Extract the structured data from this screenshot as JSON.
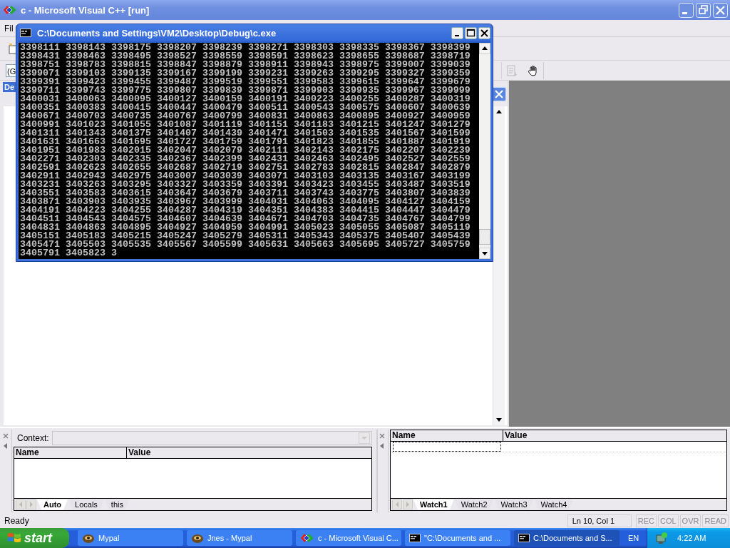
{
  "window": {
    "title": "c - Microsoft Visual C++ [run]"
  },
  "menu": [
    "Fil"
  ],
  "toolbar": {
    "combo": "(G"
  },
  "workspace_pane": {
    "title": "De"
  },
  "console": {
    "title": "C:\\Documents and Settings\\VM2\\Desktop\\Debug\\c.exe",
    "lines": [
      "3398111 3398143 3398175 3398207 3398239 3398271 3398303 3398335 3398367 3398399",
      "3398431 3398463 3398495 3398527 3398559 3398591 3398623 3398655 3398687 3398719",
      "3398751 3398783 3398815 3398847 3398879 3398911 3398943 3398975 3399007 3399039",
      "3399071 3399103 3399135 3399167 3399199 3399231 3399263 3399295 3399327 3399359",
      "3399391 3399423 3399455 3399487 3399519 3399551 3399583 3399615 3399647 3399679",
      "3399711 3399743 3399775 3399807 3399839 3399871 3399903 3399935 3399967 3399999",
      "3400031 3400063 3400095 3400127 3400159 3400191 3400223 3400255 3400287 3400319",
      "3400351 3400383 3400415 3400447 3400479 3400511 3400543 3400575 3400607 3400639",
      "3400671 3400703 3400735 3400767 3400799 3400831 3400863 3400895 3400927 3400959",
      "3400991 3401023 3401055 3401087 3401119 3401151 3401183 3401215 3401247 3401279",
      "3401311 3401343 3401375 3401407 3401439 3401471 3401503 3401535 3401567 3401599",
      "3401631 3401663 3401695 3401727 3401759 3401791 3401823 3401855 3401887 3401919",
      "3401951 3401983 3402015 3402047 3402079 3402111 3402143 3402175 3402207 3402239",
      "3402271 3402303 3402335 3402367 3402399 3402431 3402463 3402495 3402527 3402559",
      "3402591 3402623 3402655 3402687 3402719 3402751 3402783 3402815 3402847 3402879",
      "3402911 3402943 3402975 3403007 3403039 3403071 3403103 3403135 3403167 3403199",
      "3403231 3403263 3403295 3403327 3403359 3403391 3403423 3403455 3403487 3403519",
      "3403551 3403583 3403615 3403647 3403679 3403711 3403743 3403775 3403807 3403839",
      "3403871 3403903 3403935 3403967 3403999 3404031 3404063 3404095 3404127 3404159",
      "3404191 3404223 3404255 3404287 3404319 3404351 3404383 3404415 3404447 3404479",
      "3404511 3404543 3404575 3404607 3404639 3404671 3404703 3404735 3404767 3404799",
      "3404831 3404863 3404895 3404927 3404959 3404991 3405023 3405055 3405087 3405119",
      "3405151 3405183 3405215 3405247 3405279 3405311 3405343 3405375 3405407 3405439",
      "3405471 3405503 3405535 3405567 3405599 3405631 3405663 3405695 3405727 3405759",
      "3405791 3405823 3"
    ]
  },
  "variables": {
    "context_label": "Context:",
    "columns": [
      "Name",
      "Value"
    ],
    "tabs": [
      {
        "label": "Auto",
        "selected": true
      },
      {
        "label": "Locals",
        "selected": false
      },
      {
        "label": "this",
        "selected": false
      }
    ]
  },
  "watch": {
    "columns": [
      "Name",
      "Value"
    ],
    "editing": true,
    "tabs": [
      {
        "label": "Watch1",
        "selected": true
      },
      {
        "label": "Watch2",
        "selected": false
      },
      {
        "label": "Watch3",
        "selected": false
      },
      {
        "label": "Watch4",
        "selected": false
      }
    ]
  },
  "status_bar": {
    "text": "Ready",
    "position": "Ln 10, Col 1",
    "indicators": [
      {
        "label": "REC",
        "on": false
      },
      {
        "label": "COL",
        "on": false
      },
      {
        "label": "OVR",
        "on": false
      },
      {
        "label": "READ",
        "on": false
      }
    ]
  },
  "taskbar": {
    "start": "start",
    "buttons": [
      {
        "label": "Mypal",
        "kind": "browser",
        "selected": false
      },
      {
        "label": "Jnes - Mypal",
        "kind": "browser",
        "selected": false
      },
      {
        "label": "c - Microsoft Visual C...",
        "kind": "ide",
        "selected": false
      },
      {
        "label": "\"C:\\Documents and ...",
        "kind": "console",
        "selected": false
      },
      {
        "label": "C:\\Documents and S...",
        "kind": "console",
        "selected": true
      }
    ],
    "language": "EN",
    "clock": "4:22 AM"
  }
}
